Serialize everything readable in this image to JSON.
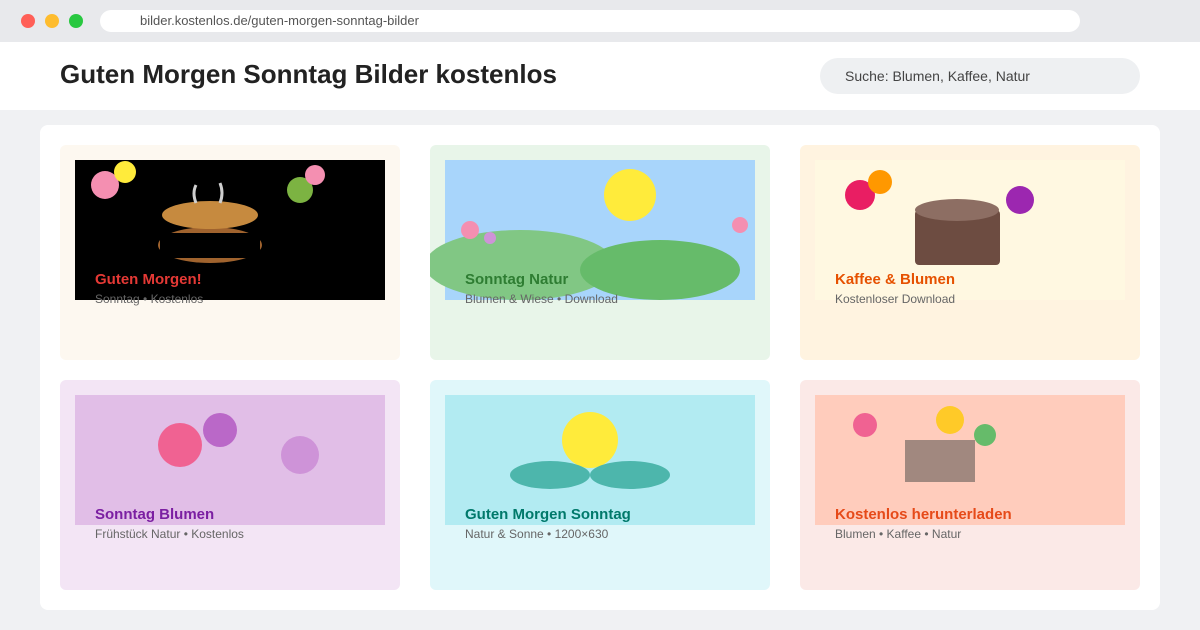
{
  "browser": {
    "url": "bilder.kostenlos.de/guten-morgen-sonntag-bilder"
  },
  "header": {
    "title": "Guten Morgen Sonntag Bilder kostenlos",
    "search_placeholder": "Suche: Blumen, Kaffee, Natur"
  },
  "cards": [
    {
      "title": "Guten Morgen!",
      "subtitle": "Sonntag • Kostenlos",
      "title_color": "#e53935"
    },
    {
      "title": "Sonntag Natur",
      "subtitle": "Blumen & Wiese • Download",
      "title_color": "#2e7d32"
    },
    {
      "title": "Kaffee & Blumen",
      "subtitle": "Kostenloser Download",
      "title_color": "#e65100"
    },
    {
      "title": "Sonntag Blumen",
      "subtitle": "Frühstück Natur • Kostenlos",
      "title_color": "#7b1fa2"
    },
    {
      "title": "Guten Morgen Sonntag",
      "subtitle": "Natur & Sonne • 1200×630",
      "title_color": "#00796b"
    },
    {
      "title": "Kostenlos herunterladen",
      "subtitle": "Blumen • Kaffee • Natur",
      "title_color": "#e64a19"
    }
  ]
}
